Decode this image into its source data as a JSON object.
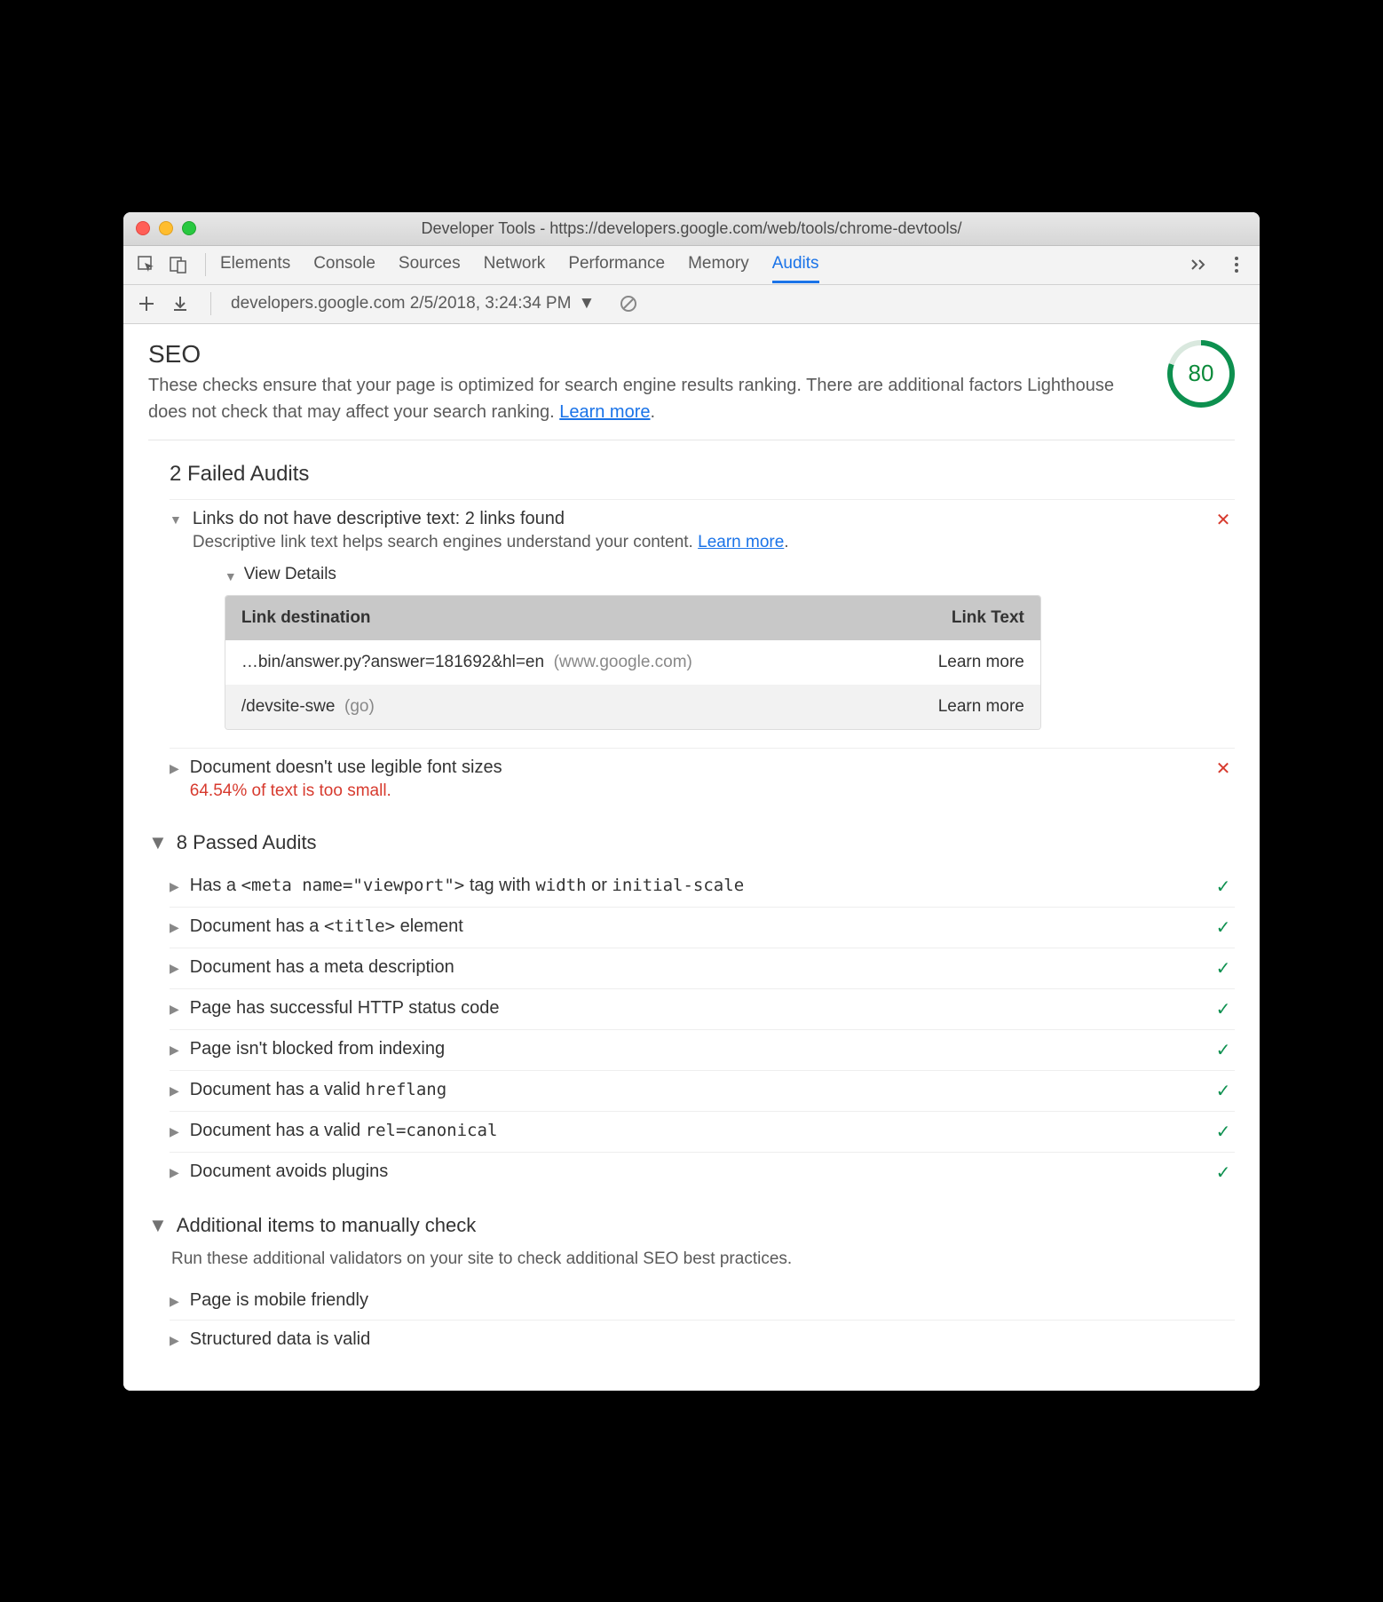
{
  "window": {
    "title": "Developer Tools - https://developers.google.com/web/tools/chrome-devtools/"
  },
  "tabs": {
    "items": [
      "Elements",
      "Console",
      "Sources",
      "Network",
      "Performance",
      "Memory",
      "Audits"
    ],
    "active": "Audits"
  },
  "toolbar": {
    "report_label": "developers.google.com 2/5/2018, 3:24:34 PM"
  },
  "seo": {
    "title": "SEO",
    "desc_a": "These checks ensure that your page is optimized for search engine results ranking. There are additional factors Lighthouse does not check that may affect your search ranking. ",
    "learn_more": "Learn more",
    "score": "80"
  },
  "failed": {
    "heading": "2 Failed Audits",
    "items": [
      {
        "title": "Links do not have descriptive text: 2 links found",
        "sub": "Descriptive link text helps search engines understand your content. ",
        "learn_more": "Learn more",
        "expanded": true,
        "details": {
          "label": "View Details",
          "headers": {
            "dest": "Link destination",
            "text": "Link Text"
          },
          "rows": [
            {
              "dest": "…bin/answer.py?answer=181692&hl=en",
              "host": "(www.google.com)",
              "text": "Learn more"
            },
            {
              "dest": "/devsite-swe",
              "host": "(go)",
              "text": "Learn more"
            }
          ]
        }
      },
      {
        "title": "Document doesn't use legible font sizes",
        "warn": "64.54% of text is too small.",
        "expanded": false
      }
    ]
  },
  "passed": {
    "heading": "8 Passed Audits",
    "items": [
      {
        "pre": "Has a ",
        "code": "<meta name=\"viewport\">",
        "mid": " tag with ",
        "code2": "width",
        "mid2": " or ",
        "code3": "initial-scale"
      },
      {
        "pre": "Document has a ",
        "code": "<title>",
        "mid": " element"
      },
      {
        "pre": "Document has a meta description"
      },
      {
        "pre": "Page has successful HTTP status code"
      },
      {
        "pre": "Page isn't blocked from indexing"
      },
      {
        "pre": "Document has a valid ",
        "code": "hreflang"
      },
      {
        "pre": "Document has a valid ",
        "code": "rel=canonical"
      },
      {
        "pre": "Document avoids plugins"
      }
    ]
  },
  "manual": {
    "heading": "Additional items to manually check",
    "desc": "Run these additional validators on your site to check additional SEO best practices.",
    "items": [
      {
        "title": "Page is mobile friendly"
      },
      {
        "title": "Structured data is valid"
      }
    ]
  }
}
